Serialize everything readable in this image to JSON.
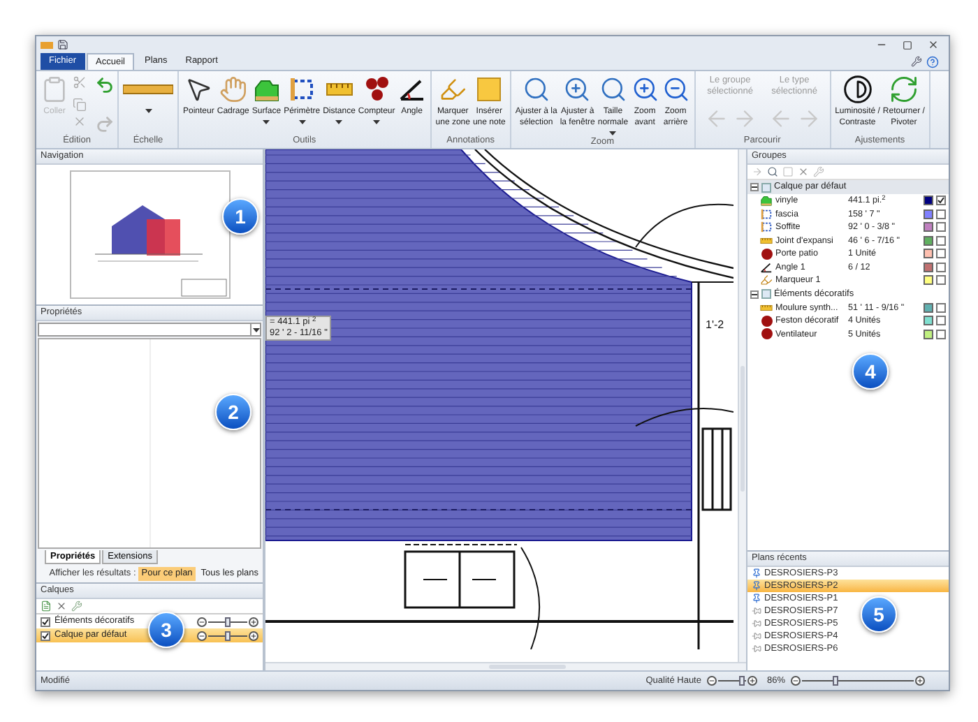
{
  "menu_tabs": [
    {
      "label": "Fichier",
      "kind": "file",
      "selected": false
    },
    {
      "label": "Accueil",
      "kind": "tab",
      "selected": true
    },
    {
      "label": "Plans",
      "kind": "tab",
      "selected": false
    },
    {
      "label": "Rapport",
      "kind": "tab",
      "selected": false
    }
  ],
  "ribbon_groups": [
    {
      "label": "Édition",
      "tools": [
        {
          "kind": "large",
          "label": [
            "Coller"
          ],
          "disabled": true
        }
      ]
    },
    {
      "label": "Échelle",
      "tools": [
        {
          "kind": "large",
          "disabled": false,
          "dropdown": true
        }
      ]
    },
    {
      "label": "Outils",
      "tools": [
        {
          "kind": "large",
          "label": [
            "Pointeur"
          ],
          "disabled": false
        },
        {
          "kind": "large",
          "label": [
            "Cadrage"
          ],
          "disabled": false
        },
        {
          "kind": "large",
          "label": [
            "Surface"
          ],
          "disabled": false,
          "dropdown": true
        },
        {
          "kind": "large",
          "label": [
            "Périmètre"
          ],
          "disabled": false,
          "dropdown": true
        },
        {
          "kind": "large",
          "label": [
            "Distance"
          ],
          "disabled": false,
          "dropdown": true
        },
        {
          "kind": "large",
          "label": [
            "Compteur"
          ],
          "disabled": false,
          "dropdown": true
        },
        {
          "kind": "large",
          "label": [
            "Angle"
          ],
          "disabled": false
        }
      ]
    },
    {
      "label": "Annotations",
      "tools": [
        {
          "kind": "large",
          "label": [
            "Marquer",
            "une zone"
          ],
          "disabled": false
        },
        {
          "kind": "large",
          "label": [
            "Insérer",
            "une note"
          ],
          "disabled": false
        }
      ]
    },
    {
      "label": "Zoom",
      "tools": [
        {
          "kind": "large",
          "label": [
            "Ajuster à la",
            "sélection"
          ],
          "disabled": false
        },
        {
          "kind": "large",
          "label": [
            "Ajuster à",
            "la fenêtre"
          ],
          "disabled": false
        },
        {
          "kind": "large",
          "label": [
            "Taille",
            "normale"
          ],
          "disabled": false,
          "dropdown": true
        },
        {
          "kind": "large",
          "label": [
            "Zoom",
            "avant"
          ],
          "disabled": false
        },
        {
          "kind": "large",
          "label": [
            "Zoom",
            "arrière"
          ],
          "disabled": false
        }
      ]
    },
    {
      "label": "Parcourir",
      "tools": [
        {
          "kind": "nav",
          "label": [
            "Le groupe",
            "sélectionné"
          ],
          "disabled": true
        },
        {
          "kind": "nav",
          "label": [
            "Le type",
            "sélectionné"
          ],
          "disabled": true
        }
      ]
    },
    {
      "label": "Ajustements",
      "tools": [
        {
          "kind": "large",
          "label": [
            "Luminosité /",
            "Contraste"
          ],
          "disabled": false
        },
        {
          "kind": "large",
          "label": [
            "Retourner /",
            "Pivoter"
          ],
          "disabled": false
        }
      ]
    }
  ],
  "navigation": {
    "title": "Navigation"
  },
  "properties": {
    "title": "Propriétés",
    "tabs": [
      {
        "label": "Propriétés",
        "selected": true
      },
      {
        "label": "Extensions",
        "selected": false
      }
    ],
    "results_label": "Afficher les résultats :",
    "results_options": [
      {
        "label": "Pour ce plan",
        "selected": true
      },
      {
        "label": "Tous les plans",
        "selected": false
      }
    ]
  },
  "layers": {
    "title": "Calques",
    "items": [
      {
        "name": "Éléments décoratifs",
        "checked": true,
        "selected": false,
        "level": 0.5
      },
      {
        "name": "Calque par défaut",
        "checked": true,
        "selected": true,
        "level": 0.5
      }
    ]
  },
  "canvas": {
    "tooltip": [
      "= 441.1 pi $^{2}$",
      "92 ' 2 - 11/16 \""
    ],
    "dimension": "1'-2"
  },
  "groups": {
    "title": "Groupes",
    "items": [
      {
        "name": "Calque par défaut",
        "expanded": true,
        "selected": true,
        "children": [
          {
            "kind": "surface",
            "name": "vinyle",
            "value": "441.1 pi.$^{2}$",
            "color": "#000080",
            "checked": true
          },
          {
            "kind": "perimeter",
            "name": "fascia",
            "value": "158 ' 7 \"",
            "color": "#8080ff",
            "checked": false
          },
          {
            "kind": "perimeter",
            "name": "Soffite",
            "value": "92 ' 0 - 3/8 \"",
            "color": "#c080c0",
            "checked": false
          },
          {
            "kind": "distance",
            "name": "Joint d'expansi",
            "value": "46 ' 6 - 7/16 \"",
            "color": "#60b060",
            "checked": false
          },
          {
            "kind": "count",
            "name": "Porte patio",
            "value": "1 Unité",
            "color": "#ffc0b0",
            "checked": false
          },
          {
            "kind": "angle",
            "name": "Angle 1",
            "value": "6 / 12",
            "color": "#c07070",
            "checked": false
          },
          {
            "kind": "marker",
            "name": "Marqueur 1",
            "color": "#ffff80",
            "checked": false
          }
        ]
      },
      {
        "name": "Éléments décoratifs",
        "expanded": true,
        "selected": false,
        "children": [
          {
            "kind": "distance",
            "name": "Moulure synth...",
            "value": "51 ' 11 - 9/16 \"",
            "color": "#60b0b0",
            "checked": false
          },
          {
            "kind": "count",
            "name": "Feston décoratif",
            "value": "4 Unités",
            "color": "#80e0d0",
            "checked": false
          },
          {
            "kind": "count",
            "name": "Ventilateur",
            "value": "5 Unités",
            "color": "#c0f080",
            "checked": false
          }
        ]
      }
    ]
  },
  "recent_plans": {
    "title": "Plans récents",
    "items": [
      {
        "name": "DESROSIERS-P3",
        "kind": "loaded",
        "selected": false
      },
      {
        "name": "DESROSIERS-P2",
        "kind": "loaded",
        "selected": true
      },
      {
        "name": "DESROSIERS-P1",
        "kind": "loaded",
        "selected": false
      },
      {
        "name": "DESROSIERS-P7",
        "kind": "unloaded",
        "selected": false
      },
      {
        "name": "DESROSIERS-P5",
        "kind": "unloaded",
        "selected": false
      },
      {
        "name": "DESROSIERS-P4",
        "kind": "unloaded",
        "selected": false
      },
      {
        "name": "DESROSIERS-P6",
        "kind": "unloaded",
        "selected": false
      }
    ]
  },
  "status_bar": {
    "status": "Modifié",
    "quality_label": "Qualité Haute",
    "quality": {
      "level": 0.85
    },
    "zoom_reading": "86%",
    "zoom": {
      "level": 0.3
    }
  },
  "callouts": [
    "1",
    "2",
    "3",
    "4",
    "5"
  ]
}
